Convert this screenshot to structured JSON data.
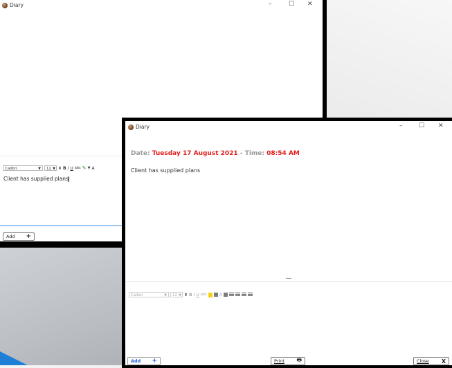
{
  "app": {
    "title": "Diary"
  },
  "window_controls": {
    "minimize": "–",
    "maximize": "☐",
    "close": "✕"
  },
  "back_window": {
    "title": "Diary",
    "toolbar": {
      "font": "Calibri",
      "size": "12",
      "bold": "B",
      "italic": "I",
      "underline": "U",
      "strike": "abc",
      "font_color": "A"
    },
    "editor_text": "Client has supplied plans",
    "add_label": "Add",
    "add_icon": "+"
  },
  "front_window": {
    "title": "Diary",
    "date_label": "Date:",
    "date_value": "Tuesday 17 August 2021",
    "time_label": "- Time:",
    "time_value": "08:54 AM",
    "note_text": "Client has supplied plans",
    "toolbar": {
      "font": "Calibri",
      "size": "12",
      "bold": "B",
      "italic": "I",
      "underline": "U",
      "strike": "abc",
      "font_color": "A"
    },
    "add_label": "Add",
    "add_icon": "+",
    "print_label": "Print",
    "close_label": "Close",
    "close_icon": "X"
  },
  "colors": {
    "accent_red": "#e21d1d",
    "label_gray": "#999999",
    "add_blue": "#1e5fd6",
    "underline_blue": "#3c8be6"
  }
}
